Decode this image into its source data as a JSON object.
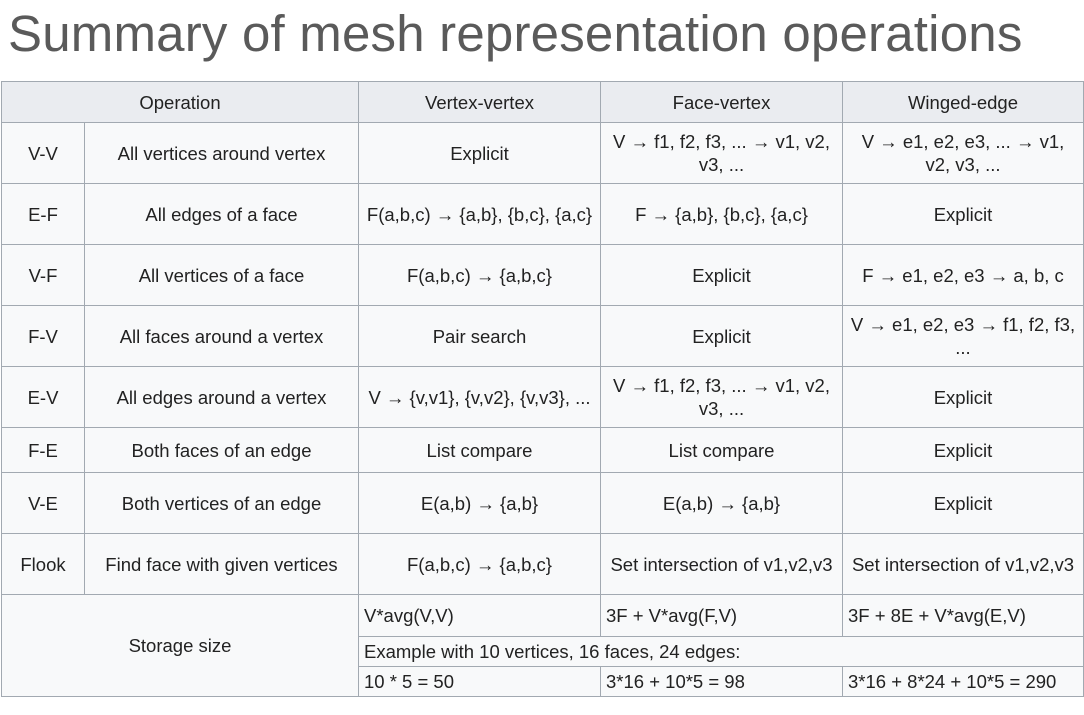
{
  "title": "Summary of mesh representation operations",
  "headers": [
    "Operation",
    "Vertex-vertex",
    "Face-vertex",
    "Winged-edge"
  ],
  "rows": [
    {
      "code": "V-V",
      "op": "All vertices around vertex",
      "vv": "Explicit",
      "fv": "V → f1, f2, f3, ... → v1, v2, v3, ...",
      "we": "V → e1, e2, e3, ... → v1, v2, v3, ..."
    },
    {
      "code": "E-F",
      "op": "All edges of a face",
      "vv": "F(a,b,c) → {a,b}, {b,c}, {a,c}",
      "fv": "F → {a,b}, {b,c}, {a,c}",
      "we": "Explicit"
    },
    {
      "code": "V-F",
      "op": "All vertices of a face",
      "vv": "F(a,b,c) → {a,b,c}",
      "fv": "Explicit",
      "we": "F → e1, e2, e3 → a, b, c"
    },
    {
      "code": "F-V",
      "op": "All faces around a vertex",
      "vv": "Pair search",
      "fv": "Explicit",
      "we": "V → e1, e2, e3 → f1, f2, f3, ..."
    },
    {
      "code": "E-V",
      "op": "All edges around a vertex",
      "vv": "V → {v,v1}, {v,v2}, {v,v3}, ...",
      "fv": "V → f1, f2, f3, ... → v1, v2, v3, ...",
      "we": "Explicit"
    },
    {
      "code": "F-E",
      "op": "Both faces of an edge",
      "vv": "List compare",
      "fv": "List compare",
      "we": "Explicit"
    },
    {
      "code": "V-E",
      "op": "Both vertices of an edge",
      "vv": "E(a,b) → {a,b}",
      "fv": "E(a,b) → {a,b}",
      "we": "Explicit"
    },
    {
      "code": "Flook",
      "op": "Find face with given vertices",
      "vv": "F(a,b,c) → {a,b,c}",
      "fv": "Set intersection of v1,v2,v3",
      "we": "Set intersection of v1,v2,v3"
    }
  ],
  "storage": {
    "label": "Storage size",
    "vv": "V*avg(V,V)",
    "fv": "3F + V*avg(F,V)",
    "we": "3F + 8E + V*avg(E,V)",
    "example": "Example with 10 vertices, 16 faces, 24 edges:",
    "ex_vv": "10 * 5 = 50",
    "ex_fv": "3*16 + 10*5 = 98",
    "ex_we": "3*16 + 8*24 + 10*5 = 290"
  }
}
